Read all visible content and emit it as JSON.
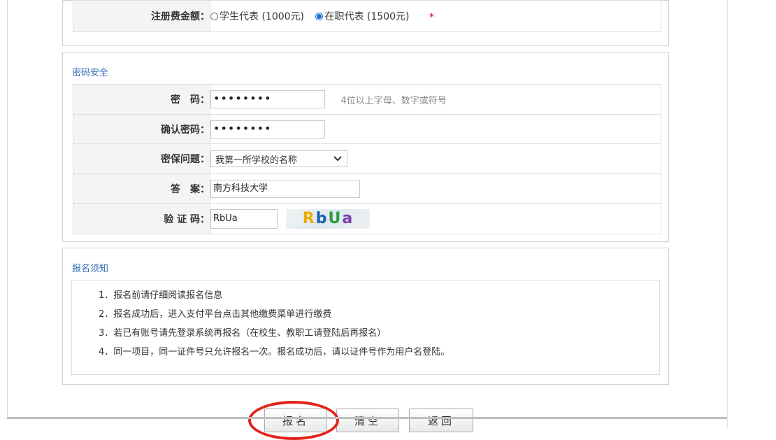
{
  "fee": {
    "label": "注册费金额：",
    "options": [
      {
        "label": "学生代表 (1000元)",
        "selected": false
      },
      {
        "label": "在职代表 (1500元)",
        "selected": true
      }
    ],
    "required_mark": "*"
  },
  "security": {
    "title": "密码安全",
    "password": {
      "label": "密　码：",
      "value": "••••••••",
      "hint": "4位以上字母、数字或符号"
    },
    "confirm": {
      "label": "确认密码：",
      "value": "••••••••"
    },
    "question": {
      "label": "密保问题：",
      "value": "我第一所学校的名称"
    },
    "answer": {
      "label": "答　案：",
      "value": "南方科技大学"
    },
    "captcha": {
      "label": "验 证 码：",
      "value": "RbUa",
      "image_chars": [
        "R",
        "b",
        "U",
        "a"
      ]
    }
  },
  "notice": {
    "title": "报名须知",
    "items": [
      "1．报名前请仔细阅读报名信息",
      "2．报名成功后，进入支付平台点击其他缴费菜单进行缴费",
      "3．若已有账号请先登录系统再报名（在校生、教职工请登陆后再报名）",
      "4．同一项目，同一证件号只允许报名一次。报名成功后，请以证件号作为用户名登陆。"
    ]
  },
  "buttons": {
    "submit": "报名",
    "clear": "清空",
    "back": "返回"
  },
  "colors": {
    "accent_blue": "#2e6db4",
    "required_red": "#d9001b",
    "highlight_red": "#e2231a",
    "captcha_chars": [
      "#f2a900",
      "#1a5fb4",
      "#2e9a3e",
      "#7a3fb0"
    ]
  }
}
